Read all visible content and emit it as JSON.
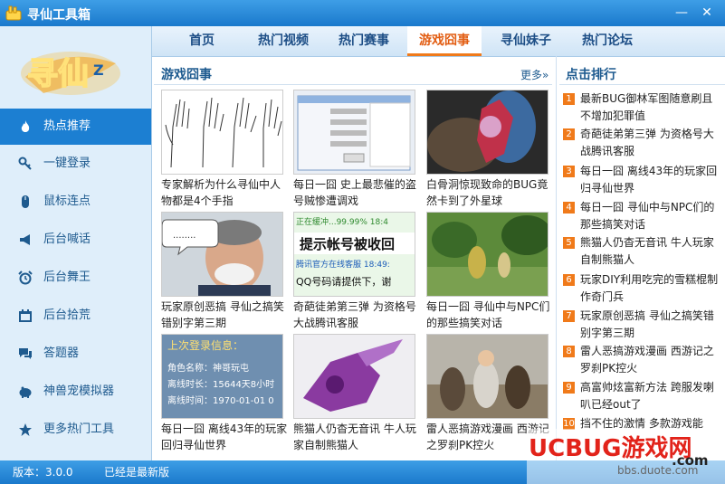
{
  "window": {
    "title": "寻仙工具箱",
    "minimize_glyph": "—",
    "close_glyph": "✕"
  },
  "logo_text": "寻仙",
  "sidebar": {
    "items": [
      {
        "label": "热点推荐",
        "icon": "flame-icon"
      },
      {
        "label": "一键登录",
        "icon": "key-icon"
      },
      {
        "label": "鼠标连点",
        "icon": "mouse-icon"
      },
      {
        "label": "后台喊话",
        "icon": "megaphone-icon"
      },
      {
        "label": "后台舞王",
        "icon": "alarm-clock-icon"
      },
      {
        "label": "后台拾荒",
        "icon": "calendar-icon"
      },
      {
        "label": "答题器",
        "icon": "chat-icon"
      },
      {
        "label": "神兽宠模拟器",
        "icon": "pig-icon"
      },
      {
        "label": "更多热门工具",
        "icon": "star-icon"
      }
    ]
  },
  "tabs": [
    {
      "label": "首页"
    },
    {
      "label": "热门视频"
    },
    {
      "label": "热门赛事"
    },
    {
      "label": "游戏囧事"
    },
    {
      "label": "寻仙妹子"
    },
    {
      "label": "热门论坛"
    }
  ],
  "main": {
    "section_title": "游戏囧事",
    "more_label": "更多»",
    "cards": [
      {
        "caption": "专家解析为什么寻仙中人物都是4个手指"
      },
      {
        "caption": "每日一囧 史上最悲催的盗号贼惨遭调戏"
      },
      {
        "caption": "白骨洞惊现致命的BUG竟然卡到了外星球"
      },
      {
        "caption": "玩家原创恶搞 寻仙之搞笑错别字第三期"
      },
      {
        "caption": "奇葩徒弟第三弹 为资格号大战腾讯客服"
      },
      {
        "caption": "每日一囧 寻仙中与NPC们的那些搞笑对话"
      },
      {
        "caption": "每日一囧 离线43年的玩家回归寻仙世界"
      },
      {
        "caption": "熊猫人仍杳无音讯 牛人玩家自制熊猫人"
      },
      {
        "caption": "雷人恶搞游戏漫画 西游记之罗刹PK控火"
      }
    ],
    "card2_thumb_text": {
      "headline": "提示帐号被收回",
      "line1": "正在缓冲...99.99% 18:4",
      "line2": "腾讯官方在线客服 18:49:",
      "line3": "QQ号码请提供下，谢"
    },
    "card6_thumb_text": {
      "line0": "上次登录信息：",
      "line1": "角色名称：神哥玩屯",
      "line2": "离线时长：15644天8小时",
      "line3": "离线时间：1970-01-01 0"
    }
  },
  "ranking": {
    "title": "点击排行",
    "items": [
      {
        "num": "1",
        "text": "最新BUG御林军图随意刷且不增加犯罪值"
      },
      {
        "num": "2",
        "text": "奇葩徒弟第三弹 为资格号大战腾讯客服"
      },
      {
        "num": "3",
        "text": "每日一囧 离线43年的玩家回归寻仙世界"
      },
      {
        "num": "4",
        "text": "每日一囧 寻仙中与NPC们的那些搞笑对话"
      },
      {
        "num": "5",
        "text": "熊猫人仍杳无音讯 牛人玩家自制熊猫人"
      },
      {
        "num": "6",
        "text": "玩家DIY利用吃完的雪糕棍制作奇门兵"
      },
      {
        "num": "7",
        "text": "玩家原创恶搞 寻仙之搞笑错别字第三期"
      },
      {
        "num": "8",
        "text": "雷人恶搞游戏漫画 西游记之罗刹PK控火"
      },
      {
        "num": "9",
        "text": "高富帅炫富新方法 跨服发喇叭已经out了"
      },
      {
        "num": "10",
        "text": "挡不住的激情 多款游戏能"
      }
    ]
  },
  "status": {
    "version": "版本：3.0.0",
    "update_state": "已经是最新版"
  },
  "watermark": {
    "brand": "UCBUG游戏网",
    "domain": "bbs.duote.com",
    "url": ".com"
  }
}
